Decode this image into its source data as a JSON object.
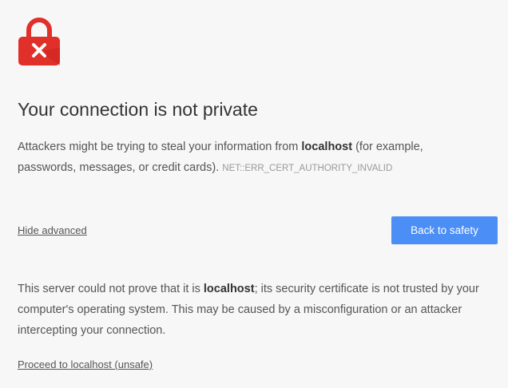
{
  "colors": {
    "background": "#f7f7f7",
    "lock": "#e1302a",
    "primary_button": "#4b8ef5"
  },
  "icon": {
    "name": "lock-error-icon"
  },
  "heading": "Your connection is not private",
  "intro": {
    "before": "Attackers might be trying to steal your information from ",
    "host": "localhost",
    "after": " (for example, passwords, messages, or credit cards).",
    "error_code": "NET::ERR_CERT_AUTHORITY_INVALID"
  },
  "actions": {
    "hide_advanced": "Hide advanced",
    "back_to_safety": "Back to safety"
  },
  "details": {
    "before": "This server could not prove that it is ",
    "host": "localhost",
    "after": "; its security certificate is not trusted by your computer's operating system. This may be caused by a misconfiguration or an attacker intercepting your connection."
  },
  "proceed_link": "Proceed to localhost (unsafe)"
}
